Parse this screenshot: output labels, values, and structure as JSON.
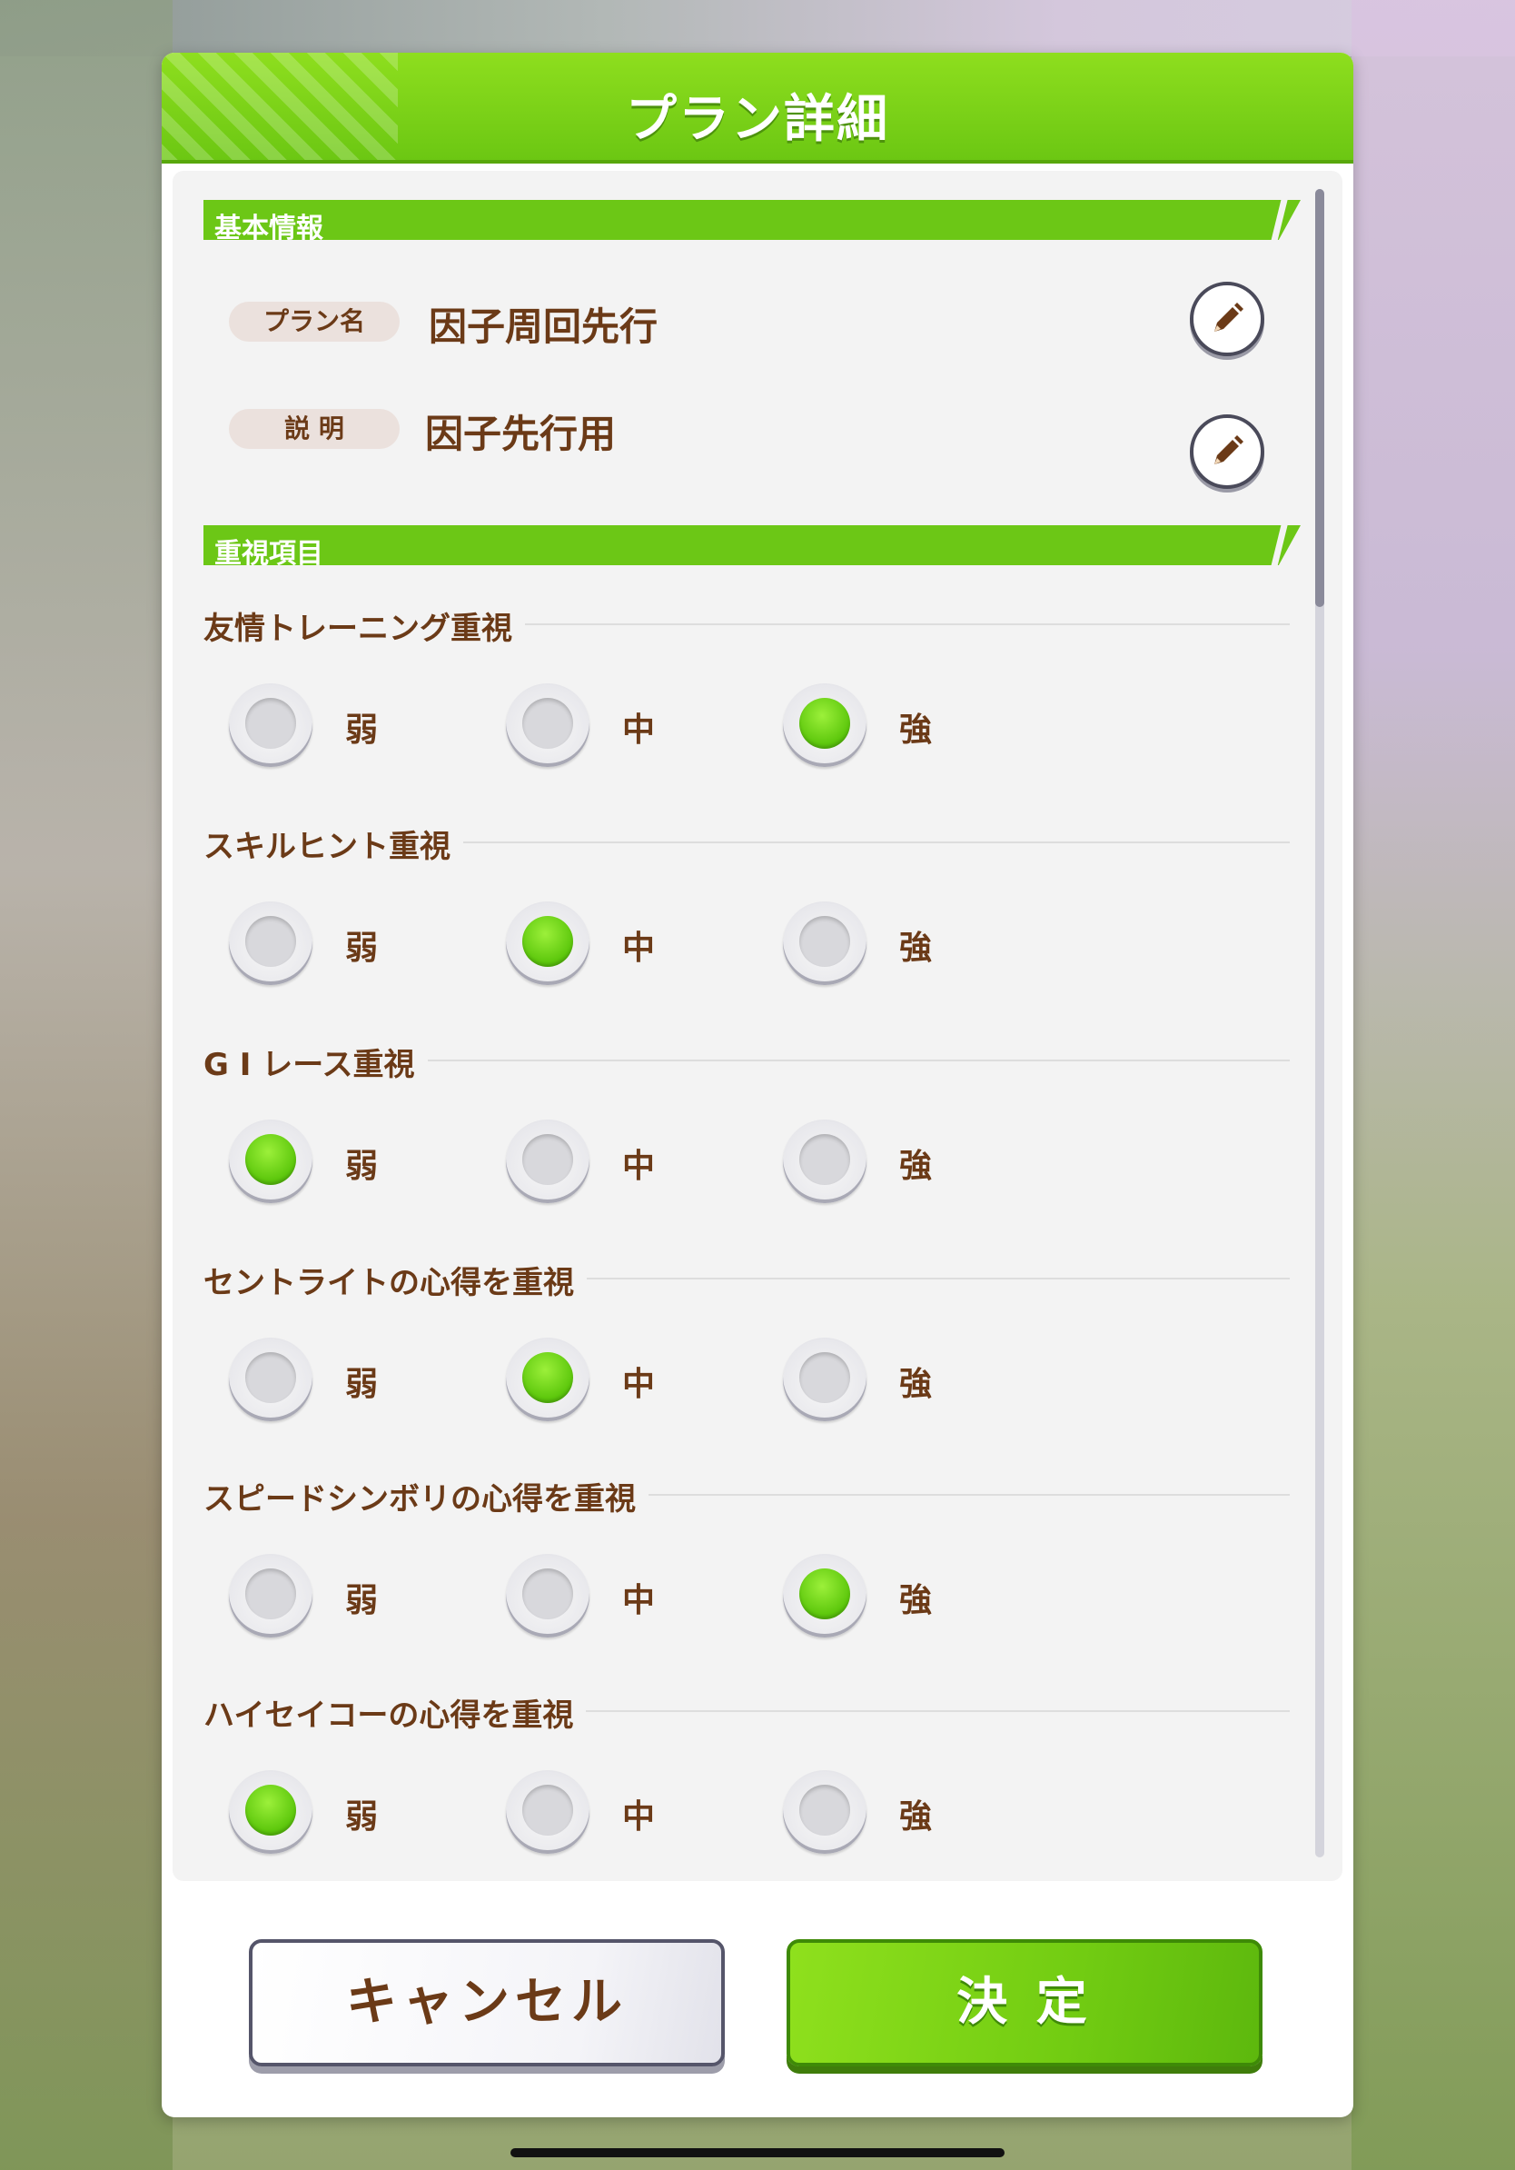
{
  "dialog": {
    "title": "プラン詳細"
  },
  "basic_info": {
    "section_label": "基本情報",
    "plan_name_tag": "プラン名",
    "plan_name_value": "因子周回先行",
    "description_tag": "説 明",
    "description_value": "因子先行用"
  },
  "priority": {
    "section_label": "重視項目",
    "option_labels": [
      "弱",
      "中",
      "強"
    ],
    "groups": [
      {
        "title": "友情トレーニング重視",
        "selected": "強"
      },
      {
        "title": "スキルヒント重視",
        "selected": "中"
      },
      {
        "title": "G I レース重視",
        "selected": "弱"
      },
      {
        "title": "セントライトの心得を重視",
        "selected": "中"
      },
      {
        "title": "スピードシンボリの心得を重視",
        "selected": "強"
      },
      {
        "title": "ハイセイコーの心得を重視",
        "selected": "弱"
      }
    ]
  },
  "footer": {
    "cancel_label": "キャンセル",
    "confirm_label": "決 定"
  },
  "colors": {
    "accent_green": "#6cc716",
    "text_brown": "#6b3a17"
  },
  "icons": {
    "edit": "pencil-icon"
  }
}
